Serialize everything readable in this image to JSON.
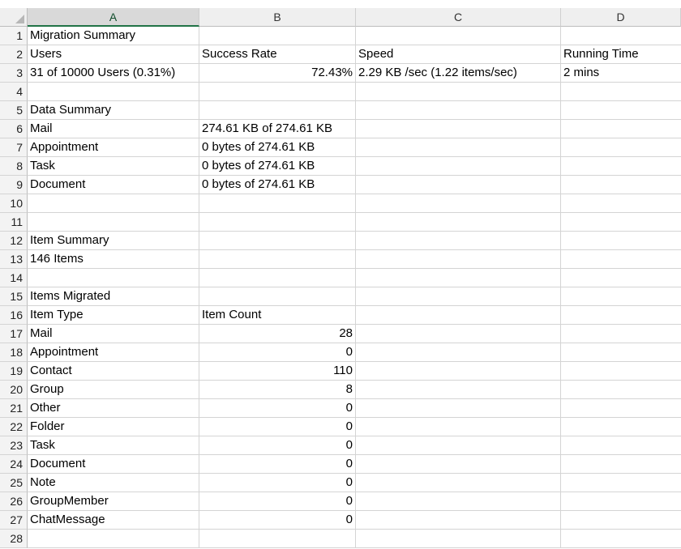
{
  "columns": [
    "A",
    "B",
    "C",
    "D"
  ],
  "rows": [
    {
      "n": "1",
      "a": "Migration Summary",
      "b": "",
      "c": "",
      "d": ""
    },
    {
      "n": "2",
      "a": "Users",
      "b": "Success Rate",
      "c": "Speed",
      "d": "Running Time"
    },
    {
      "n": "3",
      "a": "31 of 10000 Users (0.31%)",
      "b": "72.43%",
      "c": "2.29 KB /sec (1.22 items/sec)",
      "d": "2 mins"
    },
    {
      "n": "4",
      "a": "",
      "b": "",
      "c": "",
      "d": ""
    },
    {
      "n": "5",
      "a": "Data Summary",
      "b": "",
      "c": "",
      "d": ""
    },
    {
      "n": "6",
      "a": "Mail",
      "b": "274.61 KB of 274.61 KB",
      "c": "",
      "d": ""
    },
    {
      "n": "7",
      "a": "Appointment",
      "b": "0 bytes of 274.61 KB",
      "c": "",
      "d": ""
    },
    {
      "n": "8",
      "a": "Task",
      "b": "0 bytes of 274.61 KB",
      "c": "",
      "d": ""
    },
    {
      "n": "9",
      "a": "Document",
      "b": "0 bytes of 274.61 KB",
      "c": "",
      "d": ""
    },
    {
      "n": "10",
      "a": "",
      "b": "",
      "c": "",
      "d": ""
    },
    {
      "n": "11",
      "a": "",
      "b": "",
      "c": "",
      "d": ""
    },
    {
      "n": "12",
      "a": "Item Summary",
      "b": "",
      "c": "",
      "d": ""
    },
    {
      "n": "13",
      "a": "146 Items",
      "b": "",
      "c": "",
      "d": ""
    },
    {
      "n": "14",
      "a": "",
      "b": "",
      "c": "",
      "d": ""
    },
    {
      "n": "15",
      "a": "Items Migrated",
      "b": "",
      "c": "",
      "d": ""
    },
    {
      "n": "16",
      "a": "Item Type",
      "b": "Item Count",
      "c": "",
      "d": ""
    },
    {
      "n": "17",
      "a": "Mail",
      "b": "28",
      "c": "",
      "d": ""
    },
    {
      "n": "18",
      "a": "Appointment",
      "b": "0",
      "c": "",
      "d": ""
    },
    {
      "n": "19",
      "a": "Contact",
      "b": "110",
      "c": "",
      "d": ""
    },
    {
      "n": "20",
      "a": "Group",
      "b": "8",
      "c": "",
      "d": ""
    },
    {
      "n": "21",
      "a": "Other",
      "b": "0",
      "c": "",
      "d": ""
    },
    {
      "n": "22",
      "a": "Folder",
      "b": "0",
      "c": "",
      "d": ""
    },
    {
      "n": "23",
      "a": "Task",
      "b": "0",
      "c": "",
      "d": ""
    },
    {
      "n": "24",
      "a": "Document",
      "b": "0",
      "c": "",
      "d": ""
    },
    {
      "n": "25",
      "a": "Note",
      "b": "0",
      "c": "",
      "d": ""
    },
    {
      "n": "26",
      "a": "GroupMember",
      "b": "0",
      "c": "",
      "d": ""
    },
    {
      "n": "27",
      "a": "ChatMessage",
      "b": "0",
      "c": "",
      "d": ""
    },
    {
      "n": "28",
      "a": "",
      "b": "",
      "c": "",
      "d": ""
    }
  ],
  "colors": {
    "selected_header_accent": "#217346",
    "grid": "#d4d4d4",
    "header_bg": "#efefef"
  }
}
